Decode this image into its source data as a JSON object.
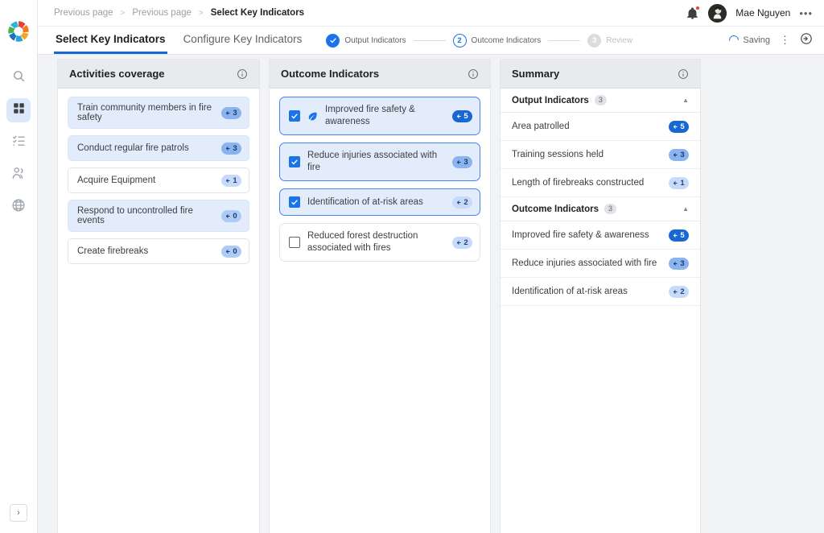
{
  "rail": {
    "logo": "pinwheel-logo",
    "items": [
      {
        "icon": "search-icon",
        "active": false
      },
      {
        "icon": "grid-icon",
        "active": true
      },
      {
        "icon": "checklist-icon",
        "active": false
      },
      {
        "icon": "people-icon",
        "active": false
      },
      {
        "icon": "globe-icon",
        "active": false
      }
    ],
    "expand": "›"
  },
  "topbar": {
    "breadcrumbs": [
      {
        "label": "Previous page",
        "current": false
      },
      {
        "label": "Previous page",
        "current": false
      },
      {
        "label": "Select Key Indicators",
        "current": true
      }
    ],
    "separator": ">",
    "bell": "notification-bell-icon",
    "user_name": "Mae Nguyen",
    "kebab": "•••"
  },
  "tabsbar": {
    "tabs": [
      {
        "label": "Select Key Indicators",
        "active": true
      },
      {
        "label": "Configure Key Indicators",
        "active": false
      }
    ],
    "steps": [
      {
        "label": "Output Indicators",
        "state": "done",
        "mark": "✓"
      },
      {
        "label": "Outcome Indicators",
        "state": "current",
        "mark": "2"
      },
      {
        "label": "Review",
        "state": "todo",
        "mark": "3"
      }
    ],
    "saving_label": "Saving",
    "kebab": "⋮",
    "exit_icon": "exit-icon"
  },
  "activities": {
    "title": "Activities coverage",
    "items": [
      {
        "label": "Train community members in fire safety",
        "count": "3",
        "selected": true,
        "badge": "mid"
      },
      {
        "label": "Conduct regular fire patrols",
        "count": "3",
        "selected": true,
        "badge": "mid"
      },
      {
        "label": "Acquire Equipment",
        "count": "1",
        "selected": false,
        "badge": "light"
      },
      {
        "label": "Respond to uncontrolled fire events",
        "count": "0",
        "selected": true,
        "badge": "pale"
      },
      {
        "label": "Create firebreaks",
        "count": "0",
        "selected": false,
        "badge": "pale"
      }
    ]
  },
  "outcomes": {
    "title": "Outcome Indicators",
    "items": [
      {
        "label": "Improved fire safety & awareness",
        "count": "5",
        "checked": true,
        "leaf": true,
        "badge": "dark"
      },
      {
        "label": "Reduce injuries associated with fire",
        "count": "3",
        "checked": true,
        "leaf": false,
        "badge": "mid"
      },
      {
        "label": "Identification of at-risk areas",
        "count": "2",
        "checked": true,
        "leaf": false,
        "badge": "light"
      },
      {
        "label": "Reduced forest destruction associated with fires",
        "count": "2",
        "checked": false,
        "leaf": false,
        "badge": "light"
      }
    ]
  },
  "summary": {
    "title": "Summary",
    "groups": [
      {
        "title": "Output Indicators",
        "count": "3",
        "caret": "▲",
        "rows": [
          {
            "label": "Area patrolled",
            "count": "5",
            "badge": "dark"
          },
          {
            "label": "Training sessions held",
            "count": "3",
            "badge": "mid"
          },
          {
            "label": "Length of firebreaks constructed",
            "count": "1",
            "badge": "light"
          }
        ]
      },
      {
        "title": "Outcome Indicators",
        "count": "3",
        "caret": "▲",
        "rows": [
          {
            "label": "Improved fire safety & awareness",
            "count": "5",
            "badge": "dark"
          },
          {
            "label": "Reduce injuries associated with fire",
            "count": "3",
            "badge": "mid"
          },
          {
            "label": "Identification of at-risk areas",
            "count": "2",
            "badge": "light"
          }
        ]
      }
    ]
  },
  "colors": {
    "accent": "#1a73e8",
    "accent_dark": "#1967d2",
    "selected_card": "#e3ecfb",
    "badge_mid": "#8ab4f0",
    "badge_light": "#c6dafc",
    "alert": "#ea4335"
  }
}
